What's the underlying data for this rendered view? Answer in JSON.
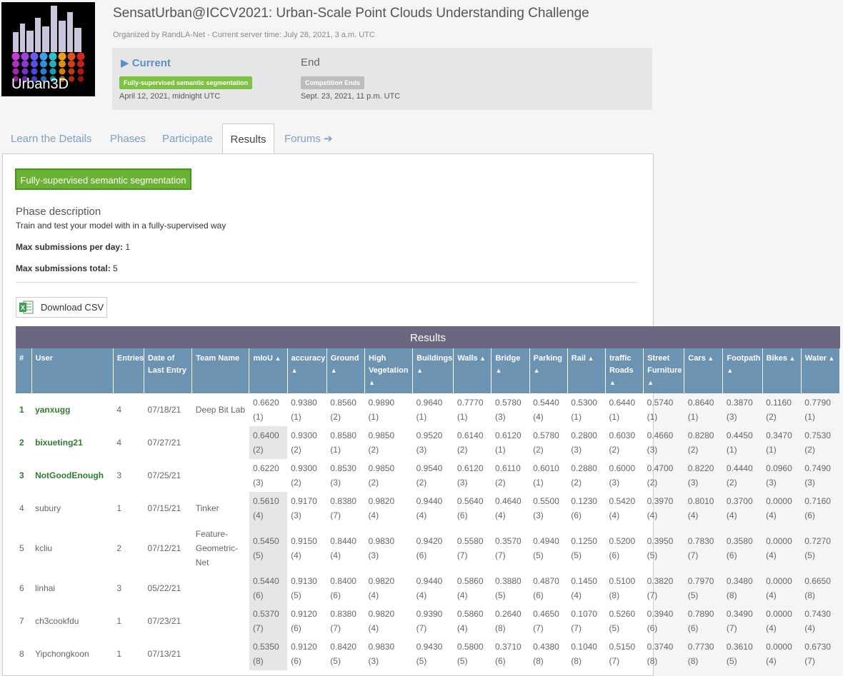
{
  "header": {
    "logo_text": "Urban3D",
    "title": "SensatUrban@ICCV2021: Urban-Scale Point Clouds Understanding Challenge",
    "subtitle": "Organized by RandLA-Net - Current server time: July 28, 2021, 3 a.m. UTC"
  },
  "phases": {
    "current_label": "Current",
    "current_badge": "Fully-supervised semantic segmentation",
    "current_date": "April 12, 2021, midnight UTC",
    "end_label": "End",
    "end_badge": "Competition Ends",
    "end_date": "Sept. 23, 2021, 11 p.m. UTC"
  },
  "tabs": [
    "Learn the Details",
    "Phases",
    "Participate",
    "Results",
    "Forums"
  ],
  "panel": {
    "phase_button": "Fully-supervised semantic segmentation",
    "phase_desc_title": "Phase description",
    "phase_desc_text": "Train and test your model with in a fully-supervised way",
    "max_day_label": "Max submissions per day:",
    "max_day_value": "1",
    "max_total_label": "Max submissions total:",
    "max_total_value": "5",
    "download_csv": "Download CSV"
  },
  "results": {
    "title": "Results",
    "columns": [
      "#",
      "User",
      "Entries",
      "Date of Last Entry",
      "Team Name",
      "mIoU",
      "accuracy",
      "Ground",
      "High Vegetation",
      "Buildings",
      "Walls",
      "Bridge",
      "Parking",
      "Rail",
      "traffic Roads",
      "Street Furniture",
      "Cars",
      "Footpath",
      "Bikes",
      "Water"
    ],
    "rows": [
      {
        "rank": "1",
        "user": "yanxugg",
        "entries": "4",
        "date": "07/18/21",
        "team": "Deep Bit Lab",
        "scores": [
          [
            "0.6620",
            "(1)"
          ],
          [
            "0.9380",
            "(1)"
          ],
          [
            "0.8560",
            "(2)"
          ],
          [
            "0.9890",
            "(1)"
          ],
          [
            "0.9640",
            "(1)"
          ],
          [
            "0.7770",
            "(1)"
          ],
          [
            "0.5780",
            "(3)"
          ],
          [
            "0.5440",
            "(4)"
          ],
          [
            "0.5300",
            "(1)"
          ],
          [
            "0.6440",
            "(1)"
          ],
          [
            "0.5740",
            "(1)"
          ],
          [
            "0.8640",
            "(1)"
          ],
          [
            "0.3870",
            "(3)"
          ],
          [
            "0.1160",
            "(2)"
          ],
          [
            "0.7790",
            "(1)"
          ]
        ]
      },
      {
        "rank": "2",
        "user": "bixueting21",
        "entries": "4",
        "date": "07/27/21",
        "team": "",
        "scores": [
          [
            "0.6400",
            "(2)"
          ],
          [
            "0.9300",
            "(2)"
          ],
          [
            "0.8580",
            "(1)"
          ],
          [
            "0.9850",
            "(2)"
          ],
          [
            "0.9520",
            "(3)"
          ],
          [
            "0.6140",
            "(2)"
          ],
          [
            "0.6120",
            "(1)"
          ],
          [
            "0.5780",
            "(2)"
          ],
          [
            "0.2800",
            "(3)"
          ],
          [
            "0.6030",
            "(2)"
          ],
          [
            "0.4660",
            "(3)"
          ],
          [
            "0.8280",
            "(2)"
          ],
          [
            "0.4450",
            "(1)"
          ],
          [
            "0.3470",
            "(1)"
          ],
          [
            "0.7530",
            "(2)"
          ]
        ]
      },
      {
        "rank": "3",
        "user": "NotGoodEnough",
        "entries": "3",
        "date": "07/25/21",
        "team": "",
        "scores": [
          [
            "0.6220",
            "(3)"
          ],
          [
            "0.9300",
            "(2)"
          ],
          [
            "0.8530",
            "(3)"
          ],
          [
            "0.9850",
            "(2)"
          ],
          [
            "0.9540",
            "(2)"
          ],
          [
            "0.6120",
            "(3)"
          ],
          [
            "0.6110",
            "(2)"
          ],
          [
            "0.6010",
            "(1)"
          ],
          [
            "0.2880",
            "(2)"
          ],
          [
            "0.6000",
            "(3)"
          ],
          [
            "0.4700",
            "(2)"
          ],
          [
            "0.8220",
            "(3)"
          ],
          [
            "0.4440",
            "(2)"
          ],
          [
            "0.0960",
            "(3)"
          ],
          [
            "0.7490",
            "(3)"
          ]
        ]
      },
      {
        "rank": "4",
        "user": "subury",
        "entries": "1",
        "date": "07/15/21",
        "team": "Tinker",
        "scores": [
          [
            "0.5610",
            "(4)"
          ],
          [
            "0.9170",
            "(3)"
          ],
          [
            "0.8380",
            "(7)"
          ],
          [
            "0.9820",
            "(4)"
          ],
          [
            "0.9440",
            "(4)"
          ],
          [
            "0.5640",
            "(6)"
          ],
          [
            "0.4640",
            "(4)"
          ],
          [
            "0.5500",
            "(3)"
          ],
          [
            "0.1230",
            "(6)"
          ],
          [
            "0.5420",
            "(4)"
          ],
          [
            "0.3970",
            "(4)"
          ],
          [
            "0.8010",
            "(4)"
          ],
          [
            "0.3700",
            "(4)"
          ],
          [
            "0.0000",
            "(4)"
          ],
          [
            "0.7160",
            "(6)"
          ]
        ]
      },
      {
        "rank": "5",
        "user": "kcliu",
        "entries": "2",
        "date": "07/12/21",
        "team": "Feature-Geometric-Net",
        "scores": [
          [
            "0.5450",
            "(5)"
          ],
          [
            "0.9150",
            "(4)"
          ],
          [
            "0.8440",
            "(4)"
          ],
          [
            "0.9830",
            "(3)"
          ],
          [
            "0.9420",
            "(6)"
          ],
          [
            "0.5580",
            "(7)"
          ],
          [
            "0.3570",
            "(7)"
          ],
          [
            "0.4940",
            "(5)"
          ],
          [
            "0.1250",
            "(5)"
          ],
          [
            "0.5200",
            "(6)"
          ],
          [
            "0.3950",
            "(5)"
          ],
          [
            "0.7830",
            "(7)"
          ],
          [
            "0.3580",
            "(6)"
          ],
          [
            "0.0000",
            "(4)"
          ],
          [
            "0.7270",
            "(5)"
          ]
        ]
      },
      {
        "rank": "6",
        "user": "linhai",
        "entries": "3",
        "date": "05/22/21",
        "team": "",
        "scores": [
          [
            "0.5440",
            "(6)"
          ],
          [
            "0.9130",
            "(5)"
          ],
          [
            "0.8400",
            "(6)"
          ],
          [
            "0.9820",
            "(4)"
          ],
          [
            "0.9440",
            "(4)"
          ],
          [
            "0.5860",
            "(4)"
          ],
          [
            "0.3880",
            "(5)"
          ],
          [
            "0.4870",
            "(6)"
          ],
          [
            "0.1450",
            "(4)"
          ],
          [
            "0.5100",
            "(8)"
          ],
          [
            "0.3820",
            "(7)"
          ],
          [
            "0.7970",
            "(5)"
          ],
          [
            "0.3480",
            "(8)"
          ],
          [
            "0.0000",
            "(4)"
          ],
          [
            "0.6650",
            "(8)"
          ]
        ]
      },
      {
        "rank": "7",
        "user": "ch3cookfdu",
        "entries": "1",
        "date": "07/23/21",
        "team": "",
        "scores": [
          [
            "0.5370",
            "(7)"
          ],
          [
            "0.9120",
            "(6)"
          ],
          [
            "0.8380",
            "(7)"
          ],
          [
            "0.9820",
            "(4)"
          ],
          [
            "0.9390",
            "(7)"
          ],
          [
            "0.5860",
            "(4)"
          ],
          [
            "0.2640",
            "(8)"
          ],
          [
            "0.4650",
            "(7)"
          ],
          [
            "0.1070",
            "(7)"
          ],
          [
            "0.5260",
            "(5)"
          ],
          [
            "0.3940",
            "(6)"
          ],
          [
            "0.7890",
            "(6)"
          ],
          [
            "0.3490",
            "(7)"
          ],
          [
            "0.0000",
            "(4)"
          ],
          [
            "0.7430",
            "(4)"
          ]
        ]
      },
      {
        "rank": "8",
        "user": "Yipchongkoon",
        "entries": "1",
        "date": "07/13/21",
        "team": "",
        "scores": [
          [
            "0.5350",
            "(8)"
          ],
          [
            "0.9120",
            "(6)"
          ],
          [
            "0.8420",
            "(5)"
          ],
          [
            "0.9830",
            "(3)"
          ],
          [
            "0.9430",
            "(5)"
          ],
          [
            "0.5800",
            "(5)"
          ],
          [
            "0.3710",
            "(6)"
          ],
          [
            "0.4380",
            "(8)"
          ],
          [
            "0.1040",
            "(8)"
          ],
          [
            "0.5150",
            "(7)"
          ],
          [
            "0.3740",
            "(8)"
          ],
          [
            "0.7730",
            "(8)"
          ],
          [
            "0.3610",
            "(5)"
          ],
          [
            "0.0000",
            "(4)"
          ],
          [
            "0.6730",
            "(7)"
          ]
        ]
      }
    ]
  }
}
